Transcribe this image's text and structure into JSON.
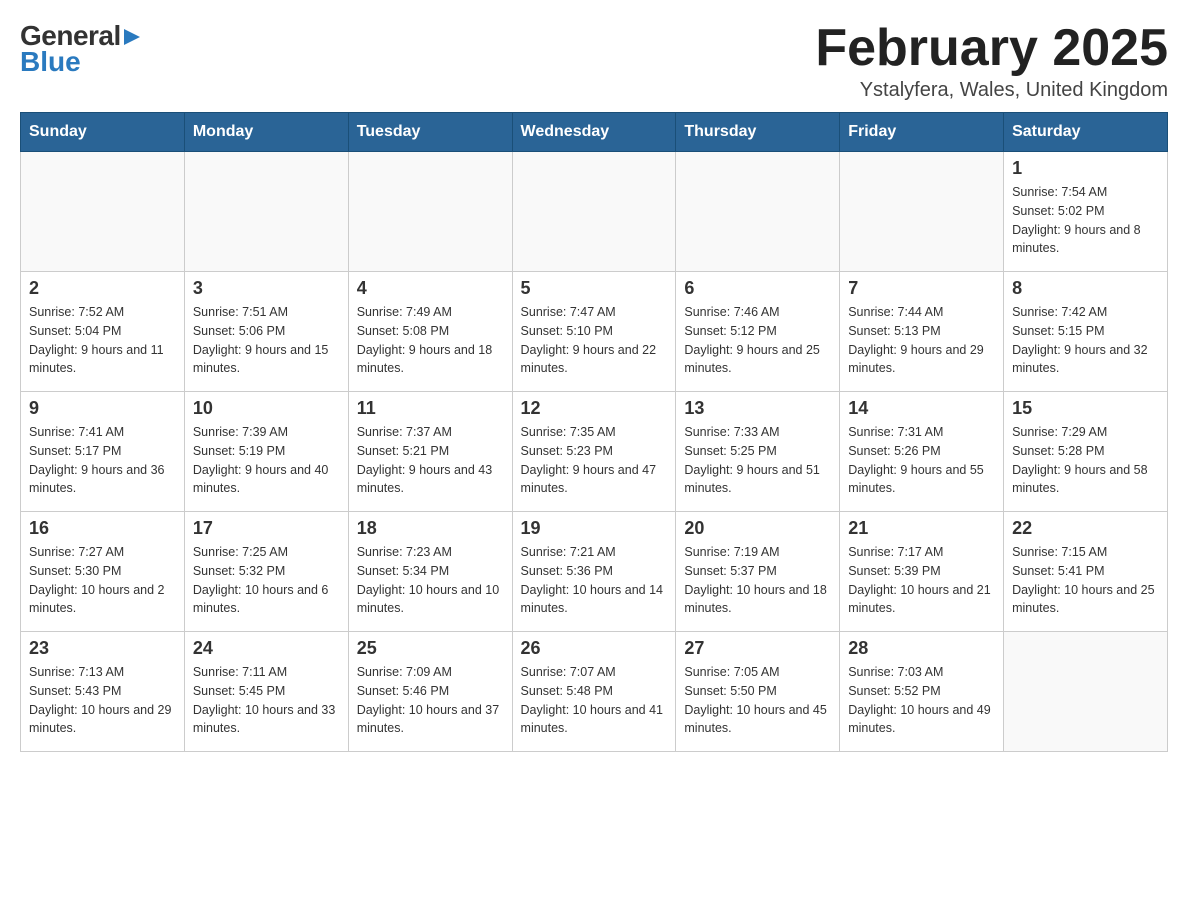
{
  "header": {
    "logo_general": "General",
    "logo_blue": "Blue",
    "month_title": "February 2025",
    "location": "Ystalyfera, Wales, United Kingdom"
  },
  "weekdays": [
    "Sunday",
    "Monday",
    "Tuesday",
    "Wednesday",
    "Thursday",
    "Friday",
    "Saturday"
  ],
  "weeks": [
    [
      {
        "day": "",
        "info": ""
      },
      {
        "day": "",
        "info": ""
      },
      {
        "day": "",
        "info": ""
      },
      {
        "day": "",
        "info": ""
      },
      {
        "day": "",
        "info": ""
      },
      {
        "day": "",
        "info": ""
      },
      {
        "day": "1",
        "info": "Sunrise: 7:54 AM\nSunset: 5:02 PM\nDaylight: 9 hours and 8 minutes."
      }
    ],
    [
      {
        "day": "2",
        "info": "Sunrise: 7:52 AM\nSunset: 5:04 PM\nDaylight: 9 hours and 11 minutes."
      },
      {
        "day": "3",
        "info": "Sunrise: 7:51 AM\nSunset: 5:06 PM\nDaylight: 9 hours and 15 minutes."
      },
      {
        "day": "4",
        "info": "Sunrise: 7:49 AM\nSunset: 5:08 PM\nDaylight: 9 hours and 18 minutes."
      },
      {
        "day": "5",
        "info": "Sunrise: 7:47 AM\nSunset: 5:10 PM\nDaylight: 9 hours and 22 minutes."
      },
      {
        "day": "6",
        "info": "Sunrise: 7:46 AM\nSunset: 5:12 PM\nDaylight: 9 hours and 25 minutes."
      },
      {
        "day": "7",
        "info": "Sunrise: 7:44 AM\nSunset: 5:13 PM\nDaylight: 9 hours and 29 minutes."
      },
      {
        "day": "8",
        "info": "Sunrise: 7:42 AM\nSunset: 5:15 PM\nDaylight: 9 hours and 32 minutes."
      }
    ],
    [
      {
        "day": "9",
        "info": "Sunrise: 7:41 AM\nSunset: 5:17 PM\nDaylight: 9 hours and 36 minutes."
      },
      {
        "day": "10",
        "info": "Sunrise: 7:39 AM\nSunset: 5:19 PM\nDaylight: 9 hours and 40 minutes."
      },
      {
        "day": "11",
        "info": "Sunrise: 7:37 AM\nSunset: 5:21 PM\nDaylight: 9 hours and 43 minutes."
      },
      {
        "day": "12",
        "info": "Sunrise: 7:35 AM\nSunset: 5:23 PM\nDaylight: 9 hours and 47 minutes."
      },
      {
        "day": "13",
        "info": "Sunrise: 7:33 AM\nSunset: 5:25 PM\nDaylight: 9 hours and 51 minutes."
      },
      {
        "day": "14",
        "info": "Sunrise: 7:31 AM\nSunset: 5:26 PM\nDaylight: 9 hours and 55 minutes."
      },
      {
        "day": "15",
        "info": "Sunrise: 7:29 AM\nSunset: 5:28 PM\nDaylight: 9 hours and 58 minutes."
      }
    ],
    [
      {
        "day": "16",
        "info": "Sunrise: 7:27 AM\nSunset: 5:30 PM\nDaylight: 10 hours and 2 minutes."
      },
      {
        "day": "17",
        "info": "Sunrise: 7:25 AM\nSunset: 5:32 PM\nDaylight: 10 hours and 6 minutes."
      },
      {
        "day": "18",
        "info": "Sunrise: 7:23 AM\nSunset: 5:34 PM\nDaylight: 10 hours and 10 minutes."
      },
      {
        "day": "19",
        "info": "Sunrise: 7:21 AM\nSunset: 5:36 PM\nDaylight: 10 hours and 14 minutes."
      },
      {
        "day": "20",
        "info": "Sunrise: 7:19 AM\nSunset: 5:37 PM\nDaylight: 10 hours and 18 minutes."
      },
      {
        "day": "21",
        "info": "Sunrise: 7:17 AM\nSunset: 5:39 PM\nDaylight: 10 hours and 21 minutes."
      },
      {
        "day": "22",
        "info": "Sunrise: 7:15 AM\nSunset: 5:41 PM\nDaylight: 10 hours and 25 minutes."
      }
    ],
    [
      {
        "day": "23",
        "info": "Sunrise: 7:13 AM\nSunset: 5:43 PM\nDaylight: 10 hours and 29 minutes."
      },
      {
        "day": "24",
        "info": "Sunrise: 7:11 AM\nSunset: 5:45 PM\nDaylight: 10 hours and 33 minutes."
      },
      {
        "day": "25",
        "info": "Sunrise: 7:09 AM\nSunset: 5:46 PM\nDaylight: 10 hours and 37 minutes."
      },
      {
        "day": "26",
        "info": "Sunrise: 7:07 AM\nSunset: 5:48 PM\nDaylight: 10 hours and 41 minutes."
      },
      {
        "day": "27",
        "info": "Sunrise: 7:05 AM\nSunset: 5:50 PM\nDaylight: 10 hours and 45 minutes."
      },
      {
        "day": "28",
        "info": "Sunrise: 7:03 AM\nSunset: 5:52 PM\nDaylight: 10 hours and 49 minutes."
      },
      {
        "day": "",
        "info": ""
      }
    ]
  ]
}
